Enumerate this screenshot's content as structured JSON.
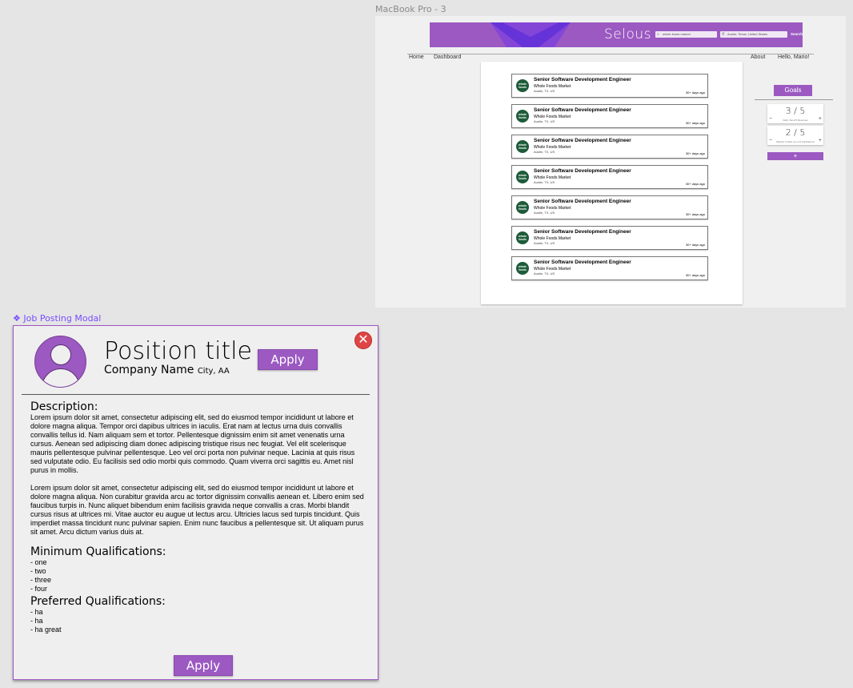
{
  "frame": {
    "label": "MacBook Pro - 3",
    "brand": "Selous",
    "search": {
      "what_value": "whole foods market",
      "where_value": "Austin, Texas, United States",
      "button_label": "Search"
    },
    "nav": {
      "home": "Home",
      "dashboard": "Dashboard",
      "about": "About",
      "greeting": "Hello, Mario!"
    },
    "jobs": [
      {
        "title": "Senior Software Development Engineer",
        "company": "Whole Foods Market",
        "location": "Austin, TX, US",
        "age": "30+ days ago"
      },
      {
        "title": "Senior Software Development Engineer",
        "company": "Whole Foods Market",
        "location": "Austin, TX, US",
        "age": "30+ days ago"
      },
      {
        "title": "Senior Software Development Engineer",
        "company": "Whole Foods Market",
        "location": "Austin, TX, US",
        "age": "30+ days ago"
      },
      {
        "title": "Senior Software Development Engineer",
        "company": "Whole Foods Market",
        "location": "Austin, TX, US",
        "age": "30+ days ago"
      },
      {
        "title": "Senior Software Development Engineer",
        "company": "Whole Foods Market",
        "location": "Austin, TX, US",
        "age": "30+ days ago"
      },
      {
        "title": "Senior Software Development Engineer",
        "company": "Whole Foods Market",
        "location": "Austin, TX, US",
        "age": "30+ days ago"
      },
      {
        "title": "Senior Software Development Engineer",
        "company": "Whole Foods Market",
        "location": "Austin, TX, US",
        "age": "30+ days ago"
      }
    ],
    "logo_text": "whole foods",
    "goals": {
      "label": "Goals",
      "items": [
        {
          "value": "3 / 5",
          "caption": "Daily: Send 5 Resumes",
          "minus": "−",
          "plus": "+"
        },
        {
          "value": "2 / 5",
          "caption": "Weekly: Follow up on 5 Applications",
          "minus": "−",
          "plus": "+"
        }
      ],
      "add_label": "+"
    }
  },
  "modal": {
    "label": "Job Posting Modal",
    "title": "Position title",
    "company": "Company Name",
    "city": "City, AA",
    "apply_label": "Apply",
    "close_glyph": "✕",
    "description_heading": "Description:",
    "paragraphs": [
      "Lorem ipsum dolor sit amet, consectetur adipiscing elit, sed do eiusmod tempor incididunt ut labore et dolore magna aliqua. Tempor orci dapibus ultrices in iaculis. Erat nam at lectus urna duis convallis convallis tellus id. Nam aliquam sem et tortor. Pellentesque dignissim enim sit amet venenatis urna cursus. Aenean sed adipiscing diam donec adipiscing tristique risus nec feugiat. Vel elit scelerisque mauris pellentesque pulvinar pellentesque. Leo vel orci porta non pulvinar neque. Lacinia at quis risus sed vulputate odio. Eu facilisis sed odio morbi quis commodo. Quam viverra orci sagittis eu. Amet nisl purus in mollis.",
      "Lorem ipsum dolor sit amet, consectetur adipiscing elit, sed do eiusmod tempor incididunt ut labore et dolore magna aliqua. Non curabitur gravida arcu ac tortor dignissim convallis aenean et. Libero enim sed faucibus turpis in. Nunc aliquet bibendum enim facilisis gravida neque convallis a cras. Morbi blandit cursus risus at ultrices mi. Vitae auctor eu augue ut lectus arcu. Ultricies lacus sed turpis tincidunt. Quis imperdiet massa tincidunt nunc pulvinar sapien. Enim nunc faucibus a pellentesque sit. Ut aliquam purus sit amet. Arcu dictum varius duis at."
    ],
    "min_heading": "Minimum Qualifications:",
    "min_items": [
      "- one",
      "- two",
      "- three",
      "- four"
    ],
    "pref_heading": "Preferred Qualifications:",
    "pref_items": [
      "- ha",
      "- ha",
      "- ha great"
    ]
  },
  "colors": {
    "accent": "#9b59c1",
    "close": "#e04545",
    "logo_green": "#1d5b3a",
    "figma_component": "#7a4bff"
  }
}
